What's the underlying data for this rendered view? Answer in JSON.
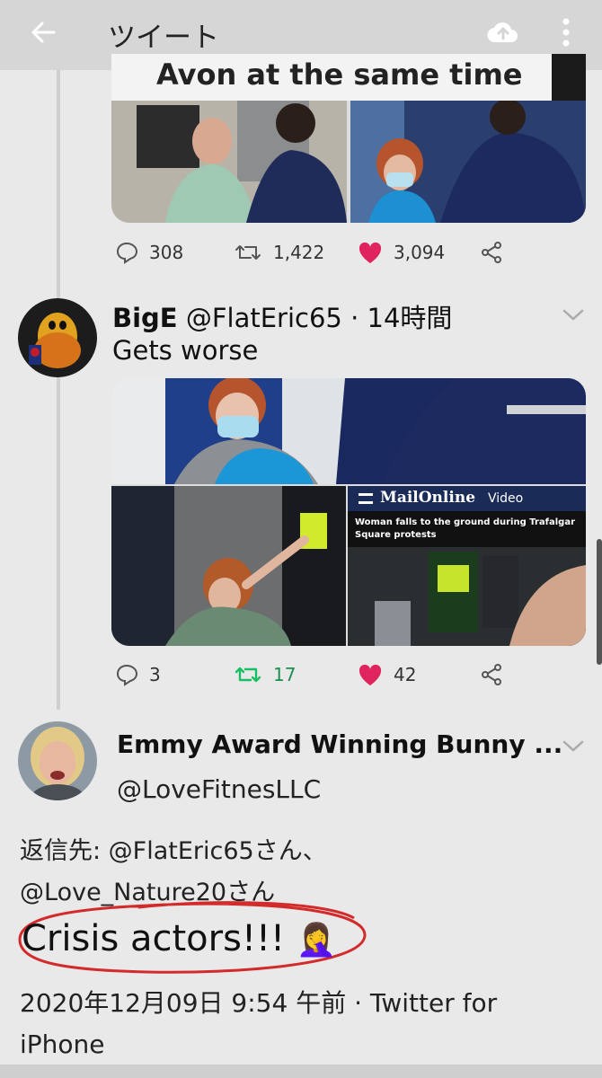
{
  "appbar": {
    "title": "ツイート"
  },
  "tweet1": {
    "image_caption": "Avon at the same time",
    "replies": "308",
    "retweets": "1,422",
    "likes": "3,094"
  },
  "tweet2": {
    "display_name": "BigE",
    "handle": "@FlatEric65",
    "time": "· 14時間",
    "text": "Gets worse",
    "mail_logo": "MailOnline",
    "mail_video": "Video",
    "mail_caption": "Woman falls to the ground during Trafalgar Square protests",
    "replies": "3",
    "retweets": "17",
    "likes": "42"
  },
  "reply": {
    "display_name": "Emmy Award Winning Bunny ...",
    "handle": "@LoveFitnesLLC",
    "reply_to_line1": "返信先: @FlatEric65さん、",
    "reply_to_line2": "@Love_Nature20さん",
    "text": "Crisis actors!!!",
    "emoji": "🤦‍♀️",
    "timestamp": "2020年12月09日 9:54 午前 · Twitter for iPhone"
  },
  "colors": {
    "like": "#e0245e",
    "retweet_active": "#17bf63",
    "annotation_red": "#d32b2b"
  }
}
